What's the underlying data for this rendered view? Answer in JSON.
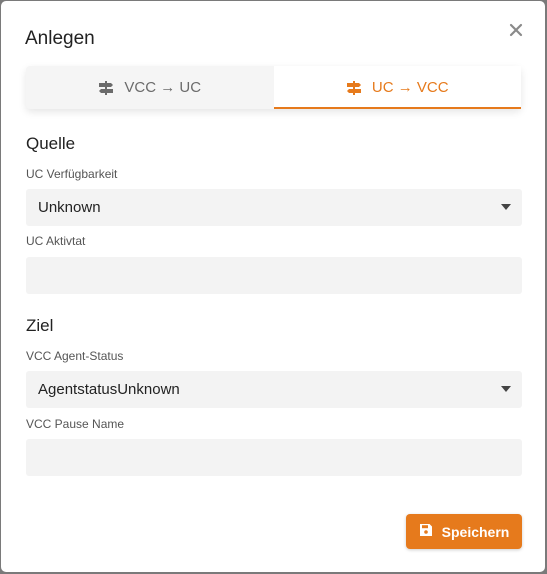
{
  "dialog": {
    "title": "Anlegen",
    "close_icon": "close-icon"
  },
  "tabs": [
    {
      "label": "VCC → UC",
      "icon": "signpost-icon",
      "active": false
    },
    {
      "label": "UC → VCC",
      "icon": "signpost-icon",
      "active": true
    }
  ],
  "source": {
    "heading": "Quelle",
    "availability_label": "UC Verfügbarkeit",
    "availability_value": "Unknown",
    "activity_label": "UC Aktivtat",
    "activity_value": ""
  },
  "target": {
    "heading": "Ziel",
    "agent_status_label": "VCC Agent-Status",
    "agent_status_value": "AgentstatusUnknown",
    "pause_name_label": "VCC Pause Name",
    "pause_name_value": ""
  },
  "footer": {
    "save_label": "Speichern",
    "save_icon": "floppy-disk-icon"
  },
  "colors": {
    "accent": "#e67a1c",
    "field_bg": "#f3f3f3",
    "inactive_tab_text": "#6b6b6b"
  }
}
